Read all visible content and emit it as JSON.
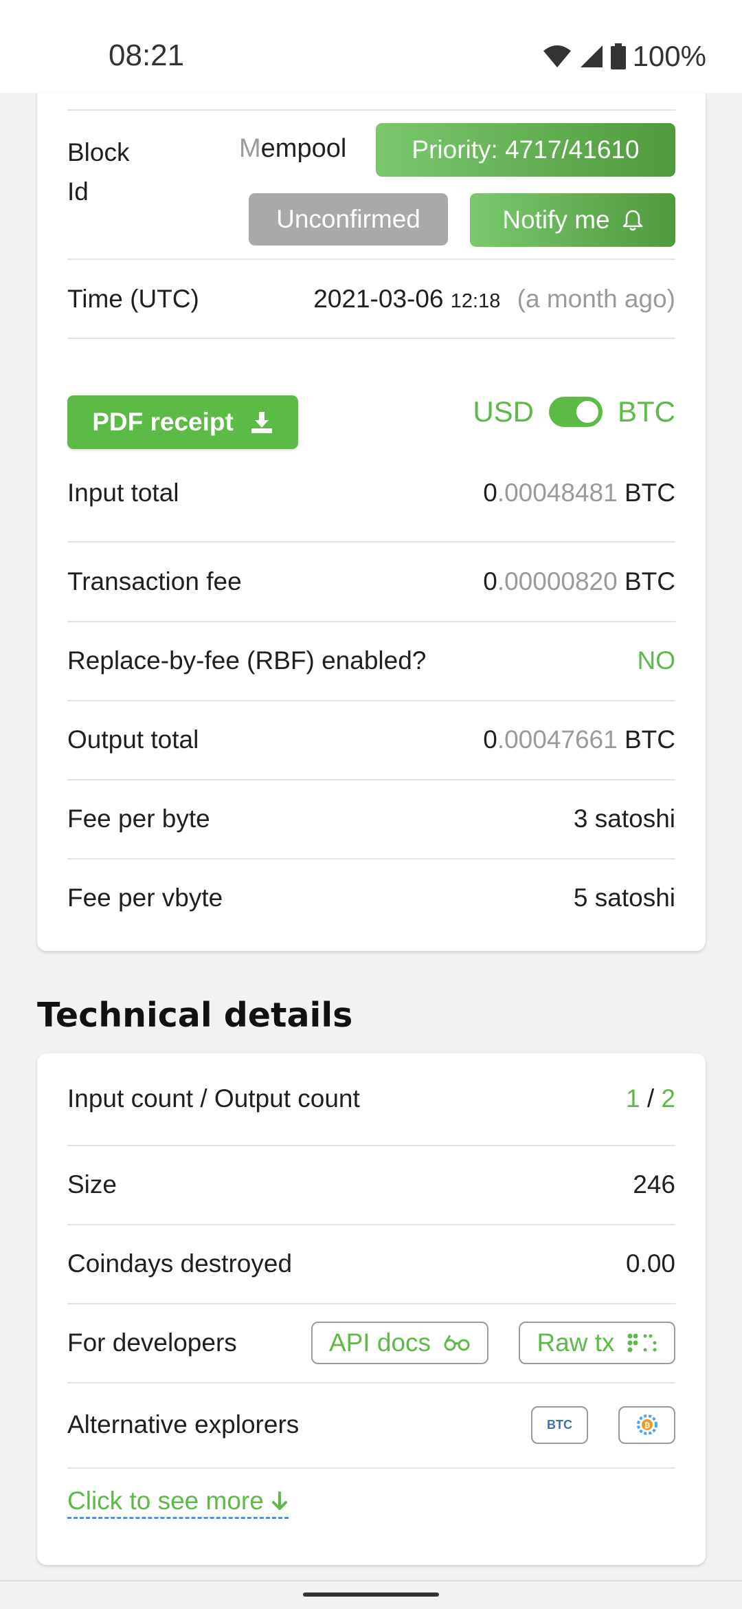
{
  "status_bar": {
    "time": "08:21",
    "battery": "100%"
  },
  "summary": {
    "block_label": "Block Id",
    "mempool_letter": "M",
    "mempool_rest": "empool",
    "priority_label": "Priority: 4717/41610",
    "unconfirmed_label": "Unconfirmed",
    "notify_label": "Notify me",
    "time_label": "Time (UTC)",
    "time_date": "2021-03-06",
    "time_clock": "12:18",
    "time_relative": "(a month ago)",
    "pdf_label": "PDF receipt",
    "currency_left": "USD",
    "currency_right": "BTC",
    "input_total_label": "Input total",
    "input_total_int": "0",
    "input_total_frac": ".00048481",
    "input_total_unit": "BTC",
    "fee_label": "Transaction fee",
    "fee_int": "0",
    "fee_frac": ".00000820",
    "fee_unit": "BTC",
    "rbf_label": "Replace-by-fee (RBF) enabled?",
    "rbf_value": "NO",
    "output_total_label": "Output total",
    "output_total_int": "0",
    "output_total_frac": ".00047661",
    "output_total_unit": "BTC",
    "fee_byte_label": "Fee per byte",
    "fee_byte_value": "3 satoshi",
    "fee_vbyte_label": "Fee per vbyte",
    "fee_vbyte_value": "5 satoshi"
  },
  "technical": {
    "title": "Technical details",
    "io_label": "Input count / Output count",
    "input_count": "1",
    "io_sep": "/",
    "output_count": "2",
    "size_label": "Size",
    "size_value": "246",
    "coindays_label": "Coindays destroyed",
    "coindays_value": "0.00",
    "dev_label": "For developers",
    "api_docs_label": "API docs",
    "raw_tx_label": "Raw tx",
    "alt_label": "Alternative explorers",
    "alt_btc_badge": "BTC",
    "see_more_label": "Click to see more"
  },
  "colors": {
    "accent": "#5cba47",
    "muted": "#9a9a9a",
    "gray_button": "#a9a9a9"
  }
}
